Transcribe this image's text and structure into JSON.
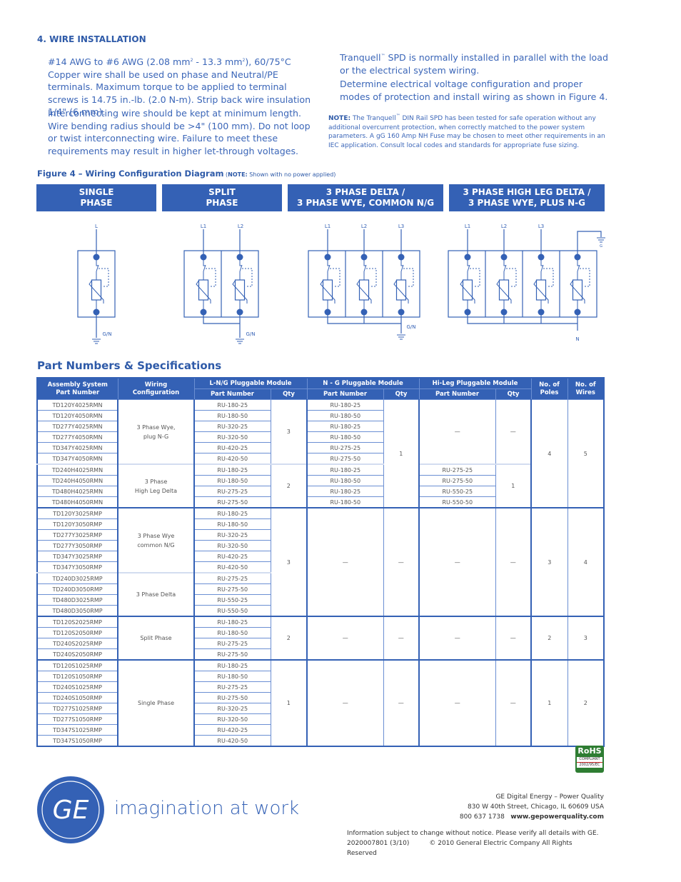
{
  "section4": {
    "heading": "4.  WIRE INSTALLATION",
    "para1_a": "#14 AWG to #6 AWG (2.08 mm",
    "sup1": "2",
    "para1_b": " - 13.3 mm",
    "sup2": "2",
    "para1_c": "), 60/75°C Copper wire shall be used on phase and Neutral/PE terminals. Maximum torque to be applied to terminal screws is 14.75 in.-lb. (2.0 N-m). Strip back wire insulation 1/4\" (6 mm).",
    "para2": "Interconnecting wire should be kept at minimum length. Wire bending radius should be >4\" (100 mm). Do not loop or twist interconnecting wire. Failure to meet these requirements may result in higher let-through voltages.",
    "para3_a": "Tranquell",
    "tm": "™",
    "para3_b": " SPD is normally installed in parallel with the load or the electrical system wiring.",
    "para4": "Determine electrical voltage configuration and proper modes of protection and install wiring as shown in Figure 4.",
    "note_label": "NOTE:",
    "note_a": " The Tranquell",
    "note_b": " DIN Rail SPD has been tested for safe operation without any additional overcurrent protection, when correctly matched to the power system parameters. A gG 160 Amp NH Fuse may be chosen to meet other requirements in an IEC application. Consult local codes and standards for appropriate fuse sizing."
  },
  "figure": {
    "title": "Figure 4 – Wiring Configuration Diagram",
    "note_open": " (",
    "note_label": "NOTE:",
    "note_text": " Shown with no power applied)",
    "configs": [
      {
        "line1": "SINGLE",
        "line2": "PHASE"
      },
      {
        "line1": "SPLIT",
        "line2": "PHASE"
      },
      {
        "line1": "3 PHASE DELTA /",
        "line2": "3 PHASE WYE, COMMON N/G"
      },
      {
        "line1": "3 PHASE HIGH LEG DELTA /",
        "line2": "3 PHASE WYE, PLUS N-G"
      }
    ],
    "labels": {
      "L": "L",
      "L1": "L1",
      "L2": "L2",
      "L3": "L3",
      "GN": "G/N",
      "G": "G",
      "N": "N"
    }
  },
  "specs": {
    "title": "Part Numbers & Specifications",
    "headers": {
      "assembly": "Assembly System Part Number",
      "assembly_1": "Assembly System",
      "assembly_2": "Part Number",
      "wiring_1": "Wiring",
      "wiring_2": "Configuration",
      "lng": "L-N/G Pluggable Module",
      "ng": "N - G Pluggable Module",
      "hileg": "Hi-Leg Pluggable Module",
      "part": "Part Number",
      "qty": "Qty",
      "poles_1": "No. of",
      "poles_2": "Poles",
      "wires_1": "No. of",
      "wires_2": "Wires"
    },
    "rows": [
      {
        "asm": "TD120Y4025RMN",
        "lng": "RU-180-25",
        "ng": "RU-180-25"
      },
      {
        "asm": "TD120Y4050RMN",
        "lng": "RU-180-50",
        "ng": "RU-180-50"
      },
      {
        "asm": "TD277Y4025RMN",
        "lng": "RU-320-25",
        "ng": "RU-180-25"
      },
      {
        "asm": "TD277Y4050RMN",
        "lng": "RU-320-50",
        "ng": "RU-180-50"
      },
      {
        "asm": "TD347Y4025RMN",
        "lng": "RU-420-25",
        "ng": "RU-275-25"
      },
      {
        "asm": "TD347Y4050RMN",
        "lng": "RU-420-50",
        "ng": "RU-275-50"
      },
      {
        "asm": "TD240H4025RMN",
        "lng": "RU-180-25",
        "ng": "RU-180-25",
        "hl": "RU-275-25"
      },
      {
        "asm": "TD240H4050RMN",
        "lng": "RU-180-50",
        "ng": "RU-180-50",
        "hl": "RU-275-50"
      },
      {
        "asm": "TD480H4025RMN",
        "lng": "RU-275-25",
        "ng": "RU-180-25",
        "hl": "RU-550-25"
      },
      {
        "asm": "TD480H4050RMN",
        "lng": "RU-275-50",
        "ng": "RU-180-50",
        "hl": "RU-550-50"
      },
      {
        "asm": "TD120Y3025RMP",
        "lng": "RU-180-25"
      },
      {
        "asm": "TD120Y3050RMP",
        "lng": "RU-180-50"
      },
      {
        "asm": "TD277Y3025RMP",
        "lng": "RU-320-25"
      },
      {
        "asm": "TD277Y3050RMP",
        "lng": "RU-320-50"
      },
      {
        "asm": "TD347Y3025RMP",
        "lng": "RU-420-25"
      },
      {
        "asm": "TD347Y3050RMP",
        "lng": "RU-420-50"
      },
      {
        "asm": "TD240D3025RMP",
        "lng": "RU-275-25"
      },
      {
        "asm": "TD240D3050RMP",
        "lng": "RU-275-50"
      },
      {
        "asm": "TD480D3025RMP",
        "lng": "RU-550-25"
      },
      {
        "asm": "TD480D3050RMP",
        "lng": "RU-550-50"
      },
      {
        "asm": "TD120S2025RMP",
        "lng": "RU-180-25"
      },
      {
        "asm": "TD120S2050RMP",
        "lng": "RU-180-50"
      },
      {
        "asm": "TD240S2025RMP",
        "lng": "RU-275-25"
      },
      {
        "asm": "TD240S2050RMP",
        "lng": "RU-275-50"
      },
      {
        "asm": "TD120S1025RMP",
        "lng": "RU-180-25"
      },
      {
        "asm": "TD120S1050RMP",
        "lng": "RU-180-50"
      },
      {
        "asm": "TD240S1025RMP",
        "lng": "RU-275-25"
      },
      {
        "asm": "TD240S1050RMP",
        "lng": "RU-275-50"
      },
      {
        "asm": "TD277S1025RMP",
        "lng": "RU-320-25"
      },
      {
        "asm": "TD277S1050RMP",
        "lng": "RU-320-50"
      },
      {
        "asm": "TD347S1025RMP",
        "lng": "RU-420-25"
      },
      {
        "asm": "TD347S1050RMP",
        "lng": "RU-420-50"
      }
    ],
    "spans": {
      "wiring": [
        {
          "start": 0,
          "count": 6,
          "line1": "3 Phase Wye,",
          "line2": "plug N-G"
        },
        {
          "start": 6,
          "count": 4,
          "line1": "3 Phase",
          "line2": "High Leg Delta"
        },
        {
          "start": 10,
          "count": 6,
          "line1": "3 Phase Wye",
          "line2": "common N/G"
        },
        {
          "start": 16,
          "count": 4,
          "line1": "3 Phase Delta",
          "line2": ""
        },
        {
          "start": 20,
          "count": 4,
          "line1": "Split Phase",
          "line2": ""
        },
        {
          "start": 24,
          "count": 8,
          "line1": "Single Phase",
          "line2": ""
        }
      ],
      "lng_qty": [
        {
          "start": 0,
          "count": 6,
          "value": "3"
        },
        {
          "start": 6,
          "count": 4,
          "value": "2"
        },
        {
          "start": 10,
          "count": 10,
          "value": "3"
        },
        {
          "start": 20,
          "count": 4,
          "value": "2"
        },
        {
          "start": 24,
          "count": 8,
          "value": "1"
        }
      ],
      "ng_qty": [
        {
          "start": 0,
          "count": 10,
          "value": "1"
        }
      ],
      "ng_dash": [
        {
          "start": 10,
          "count": 10,
          "part": "—",
          "qty": "—"
        },
        {
          "start": 20,
          "count": 4,
          "part": "—",
          "qty": "—"
        },
        {
          "start": 24,
          "count": 8,
          "part": "—",
          "qty": "—"
        }
      ],
      "hl_dash": [
        {
          "start": 0,
          "count": 6,
          "part": "—",
          "qty": "—"
        },
        {
          "start": 10,
          "count": 10,
          "part": "—",
          "qty": "—"
        },
        {
          "start": 20,
          "count": 4,
          "part": "—",
          "qty": "—"
        },
        {
          "start": 24,
          "count": 8,
          "part": "—",
          "qty": "—"
        }
      ],
      "hl_qty": [
        {
          "start": 6,
          "count": 4,
          "value": "1"
        }
      ],
      "poles_wires": [
        {
          "start": 0,
          "count": 10,
          "poles": "4",
          "wires": "5"
        },
        {
          "start": 10,
          "count": 10,
          "poles": "3",
          "wires": "4"
        },
        {
          "start": 20,
          "count": 4,
          "poles": "2",
          "wires": "3"
        },
        {
          "start": 24,
          "count": 8,
          "poles": "1",
          "wires": "2"
        }
      ]
    }
  },
  "rohs": {
    "label": "RoHS",
    "line1": "COMPLIANT",
    "line2": "2002/95/EC"
  },
  "footer": {
    "logo_text": "GE",
    "tagline": "imagination at work",
    "company": "GE Digital Energy – Power Quality",
    "address": "830 W 40th Street, Chicago, IL 60609 USA",
    "phone": "800 637 1738",
    "website": "www.gepowerquality.com",
    "disclaimer": "Information subject to change without notice.  Please verify all details with GE.",
    "doc_number": "2020007801 (3/10)",
    "copyright": "© 2010 General Electric Company  All Rights Reserved"
  }
}
